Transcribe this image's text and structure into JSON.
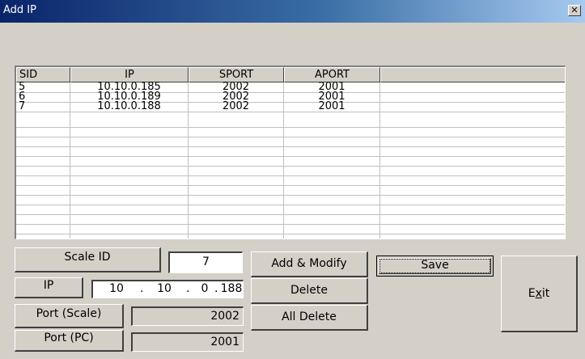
{
  "window": {
    "title": "Add IP",
    "close_glyph": "✕"
  },
  "list": {
    "columns": [
      "SID",
      "IP",
      "SPORT",
      "APORT",
      ""
    ],
    "rows": [
      {
        "sid": "5",
        "ip": "10.10.0.185",
        "sport": "2002",
        "aport": "2001"
      },
      {
        "sid": "6",
        "ip": "10.10.0.189",
        "sport": "2002",
        "aport": "2001"
      },
      {
        "sid": "7",
        "ip": "10.10.0.188",
        "sport": "2002",
        "aport": "2001"
      }
    ]
  },
  "form": {
    "scale_id_label": "Scale ID",
    "scale_id_value": "7",
    "ip_label": "IP",
    "ip_octets": [
      "10",
      "10",
      "0",
      "188"
    ],
    "port_scale_label": "Port (Scale)",
    "port_scale_value": "2002",
    "port_pc_label": "Port (PC)",
    "port_pc_value": "2001"
  },
  "buttons": {
    "add_modify": "Add & Modify",
    "delete": "Delete",
    "all_delete": "All Delete",
    "save": "Save",
    "exit_prefix": "E",
    "exit_mnemonic": "x",
    "exit_suffix": "it"
  }
}
